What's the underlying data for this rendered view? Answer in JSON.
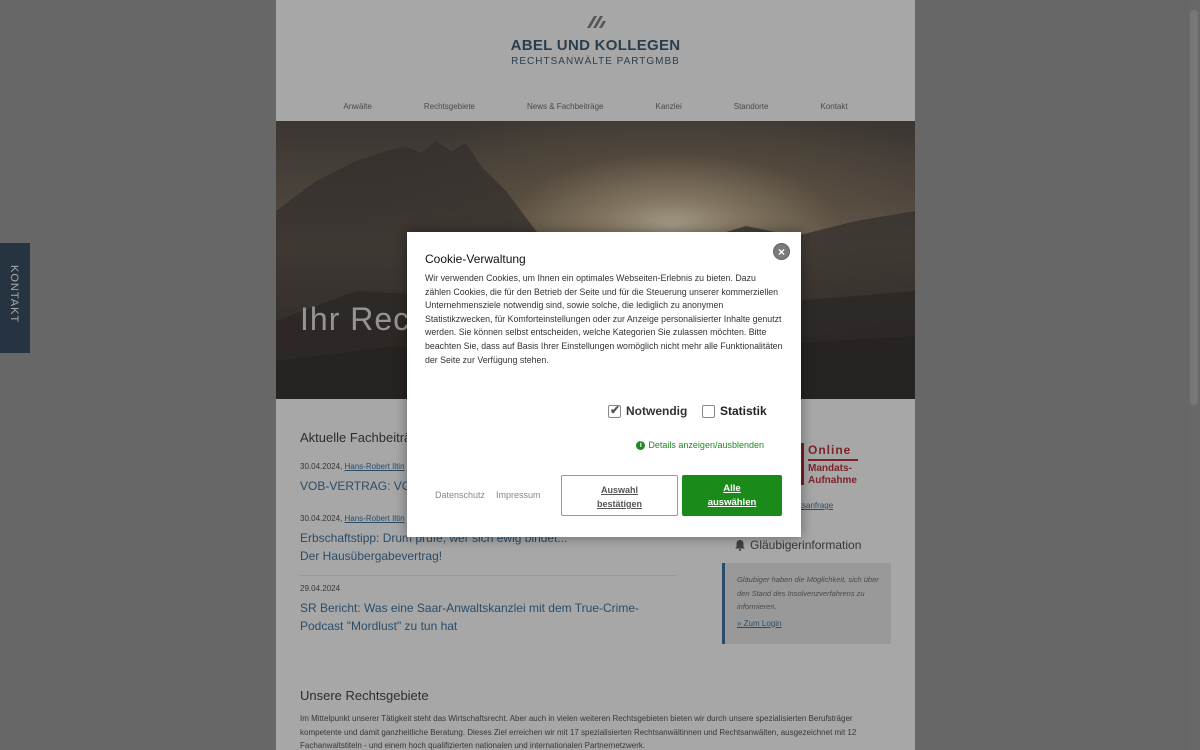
{
  "brand": {
    "name": "ABEL UND KOLLEGEN",
    "subtitle": "RECHTSANWÄLTE PARTGMBB"
  },
  "nav": {
    "items": [
      "Anwälte",
      "Rechtsgebiete",
      "News & Fachbeiträge",
      "Kanzlei",
      "Standorte",
      "Kontakt"
    ]
  },
  "hero": {
    "title": "Ihr Rech"
  },
  "posts": {
    "section_title": "Aktuelle Fachbeiträ",
    "items": [
      {
        "date": "30.04.2024,",
        "author": "Hans-Robert Iltin",
        "title": "VOB-VERTRAG: VO"
      },
      {
        "date": "30.04.2024,",
        "author": "Hans-Robert Iltin",
        "title": "Erbschaftstipp: Drum prüfe, wer sich ewig bindet... Der Hausübergabevertrag!"
      },
      {
        "date": "29.04.2024",
        "author": "",
        "title": "SR Bericht: Was eine Saar-Anwaltskanzlei mit dem True-Crime-Podcast \"Mordlust\" zu tun hat"
      }
    ]
  },
  "rechtsgebiete": {
    "title": "Unsere Rechtsgebiete",
    "text": "Im Mittelpunkt unserer Tätigkeit steht das Wirtschaftsrecht. Aber auch in vielen weiteren Rechtsgebieten bieten wir durch unsere spezialisierten Berufsträger kompetente und damit ganzheitliche Beratung. Dieses Ziel erreichen wir mit 17 spezialisierten Rechtsanwältinnen und Rechtsanwälten, ausgezeichnet mit 12 Fachanwaltstiteln - und einem hoch qualifizierten nationalen und internationalen Partnernetzwerk."
  },
  "sidebar": {
    "mandat_line1": "Online",
    "mandat_line2": "Mandats-",
    "mandat_line3": "Aufnahme",
    "mandat_link": "andatsanfrage",
    "glaeubiger_title": "Gläubigerinformation",
    "glaeubiger_text": "Gläubiger haben die Möglichkeit, sich über den Stand des Insolvenzverfahrens zu informieren.",
    "glaeubiger_link": "» Zum Login"
  },
  "kontakt_tab": "KONTAKT",
  "cookie": {
    "title": "Cookie-Verwaltung",
    "text": "Wir verwenden Cookies, um Ihnen ein optimales Webseiten-Erlebnis zu bieten. Dazu zählen Cookies, die für den Betrieb der Seite und für die Steuerung unserer kommerziellen Unternehmensziele notwendig sind, sowie solche, die lediglich zu anonymen Statistikzwecken, für Komforteinstellungen oder zur Anzeige personalisierter Inhalte genutzt werden. Sie können selbst entscheiden, welche Kategorien Sie zulassen möchten. Bitte beachten Sie, dass auf Basis Ihrer Einstellungen womöglich nicht mehr alle Funktionalitäten der Seite zur Verfügung stehen.",
    "option_necessary": "Notwendig",
    "option_necessary_checked": true,
    "option_statistics": "Statistik",
    "option_statistics_checked": false,
    "details_link": "Details anzeigen/ausblenden",
    "privacy_link": "Datenschutz",
    "imprint_link": "Impressum",
    "confirm_line1": "Auswahl",
    "confirm_line2": "bestätigen",
    "select_all_line1": "Alle",
    "select_all_line2": "auswählen"
  },
  "colors": {
    "brand_blue": "#1d3f5a",
    "link_blue": "#1d5a8c",
    "accept_green": "#1a8a1a",
    "mandat_red": "#b0101a"
  }
}
